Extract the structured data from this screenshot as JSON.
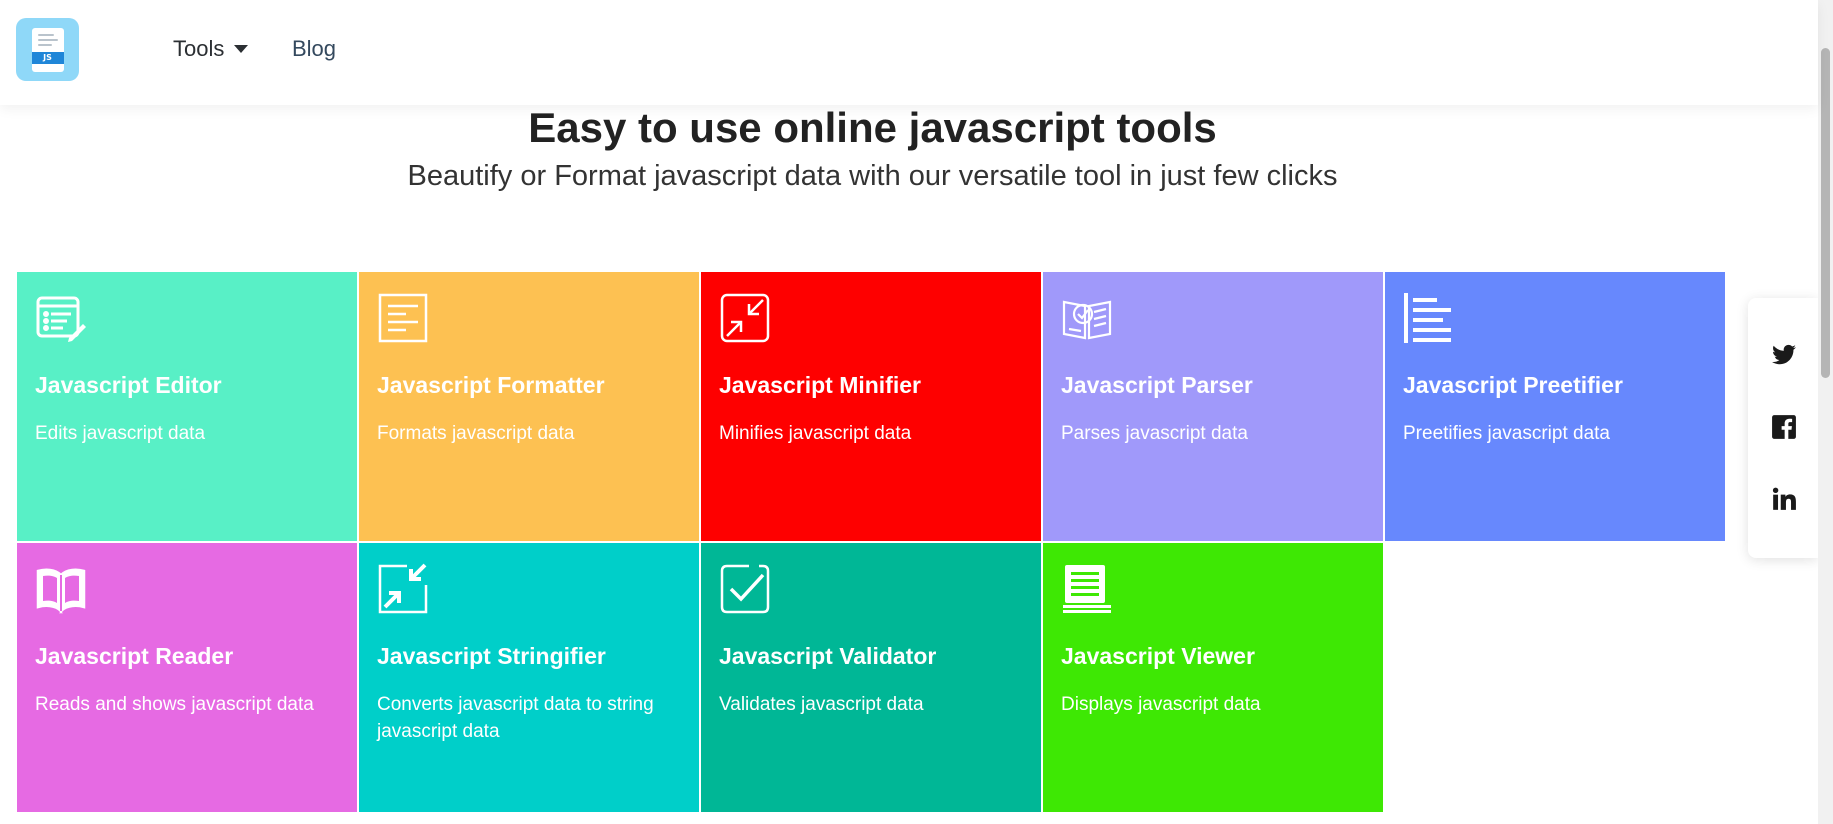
{
  "header": {
    "logo_badge": "JS",
    "nav": [
      {
        "label": "Tools"
      },
      {
        "label": "Blog"
      }
    ]
  },
  "hero": {
    "title": "Easy to use online javascript tools",
    "subtitle": "Beautify or Format javascript data with our versatile tool in just few clicks"
  },
  "tools": [
    {
      "title": "Javascript Editor",
      "desc": "Edits javascript data",
      "color": "#58f0c6",
      "icon": "list-edit-icon"
    },
    {
      "title": "Javascript Formatter",
      "desc": "Formats javascript data",
      "color": "#fdc152",
      "icon": "document-lines-icon"
    },
    {
      "title": "Javascript Minifier",
      "desc": "Minifies javascript data",
      "color": "#fe0000",
      "icon": "minimize-arrows-icon"
    },
    {
      "title": "Javascript Parser",
      "desc": "Parses javascript data",
      "color": "#a099fa",
      "icon": "book-check-icon"
    },
    {
      "title": "Javascript Preetifier",
      "desc": "Preetifies javascript data",
      "color": "#6788fd",
      "icon": "align-left-icon"
    },
    {
      "title": "Javascript Reader",
      "desc": "Reads and shows javascript data",
      "color": "#e66ae3",
      "icon": "open-book-icon"
    },
    {
      "title": "Javascript Stringifier",
      "desc": "Converts javascript data to string javascript data",
      "color": "#00cfc9",
      "icon": "compress-arrows-icon"
    },
    {
      "title": "Javascript Validator",
      "desc": "Validates javascript data",
      "color": "#00b796",
      "icon": "checkbox-icon"
    },
    {
      "title": "Javascript Viewer",
      "desc": "Displays javascript data",
      "color": "#3ee804",
      "icon": "document-stack-icon"
    }
  ],
  "social": [
    {
      "icon": "twitter-icon"
    },
    {
      "icon": "facebook-icon"
    },
    {
      "icon": "linkedin-icon"
    }
  ]
}
